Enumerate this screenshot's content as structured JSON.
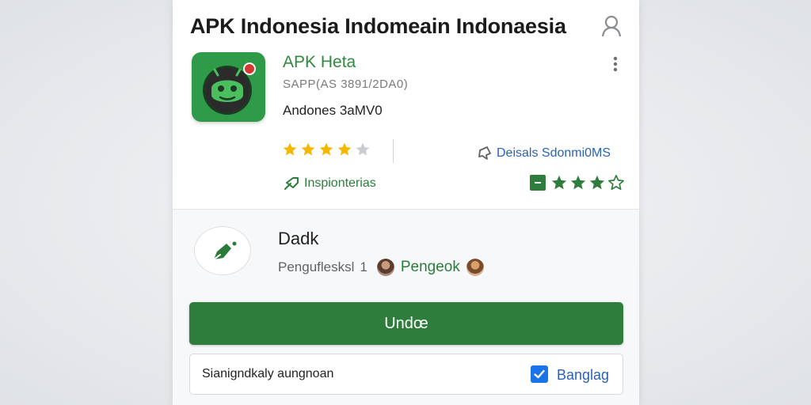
{
  "header": {
    "title": "APK Indonesia Indomeain Indonaesia",
    "profile_icon": "user-icon"
  },
  "app": {
    "name": "APK Heta",
    "code": "SAPP(AS 3891/2DA0)",
    "description": "Andones 3aMV0",
    "icon": "android-robot-icon",
    "accent_color": "#2f9a47",
    "rating": 4,
    "rating_max": 5
  },
  "links": {
    "details": "Deisals Sdonmi0MS",
    "inspiration": "Inspionterias"
  },
  "badge_rating": {
    "value": 3,
    "max": 4
  },
  "section": {
    "title": "Dadk",
    "subtitle": "Penguflesksl",
    "count": "1",
    "highlight": "Pengeok"
  },
  "primary_button": {
    "label": "Undœ",
    "color": "#2f7d3c"
  },
  "option": {
    "label": "Sianigndkaly aungnoan",
    "action": "Banglag",
    "checked": true,
    "checkbox_color": "#1a73e8"
  }
}
